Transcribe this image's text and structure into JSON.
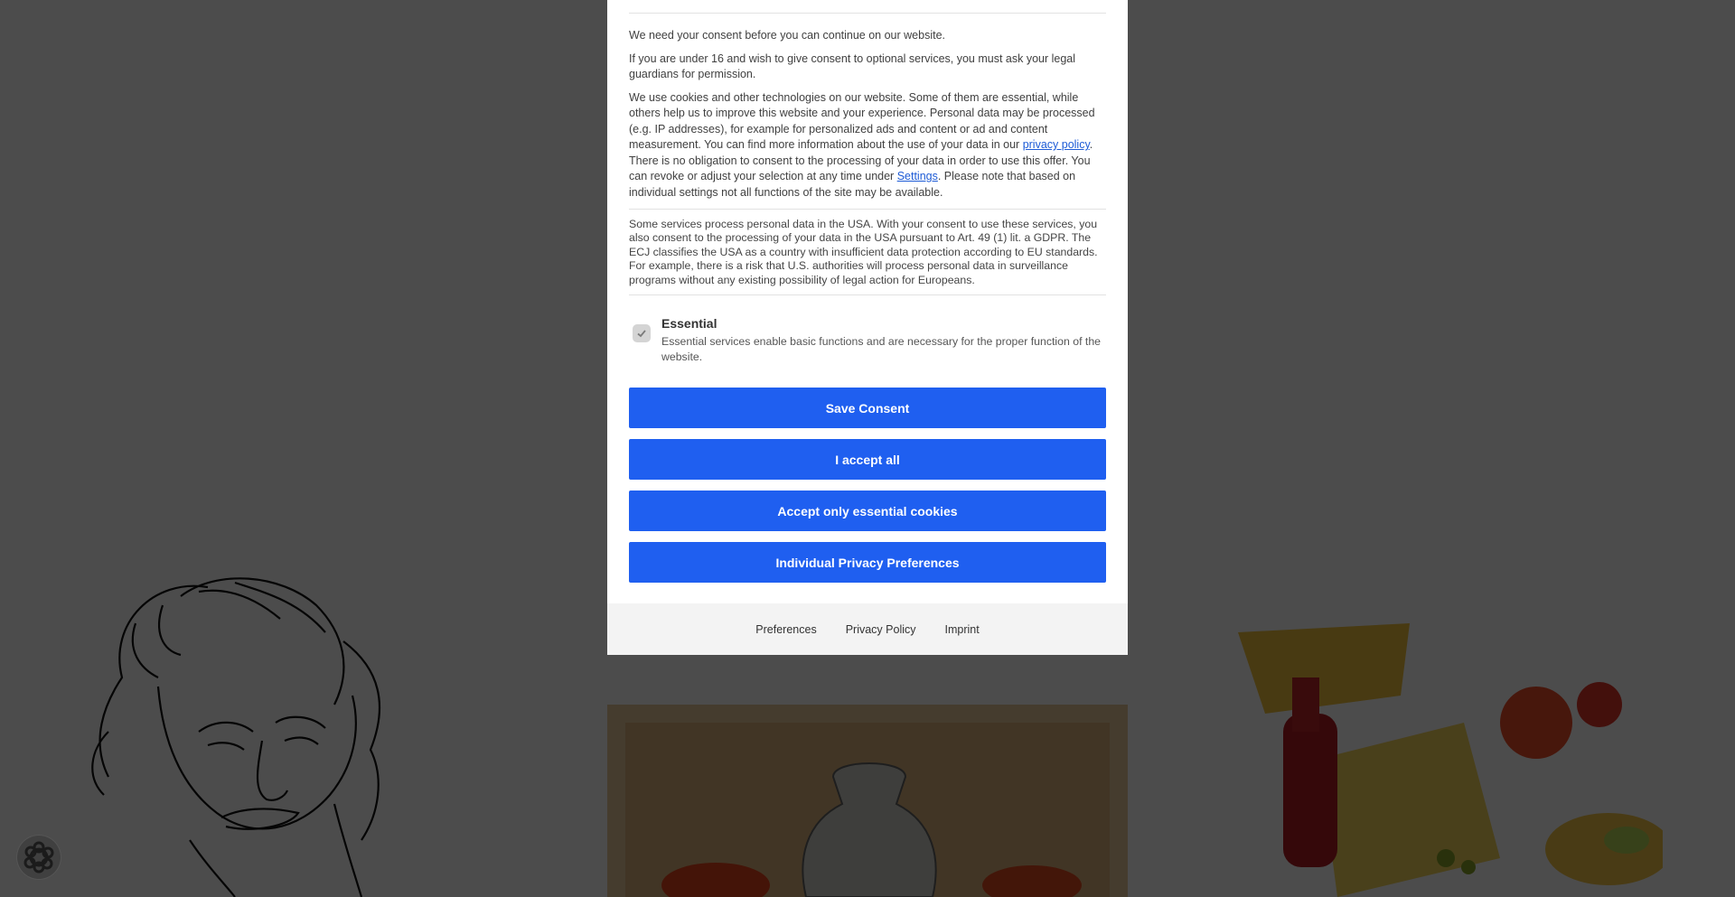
{
  "consent_dialog": {
    "intro": "We need your consent before you can continue on our website.",
    "under16": "If you are under 16 and wish to give consent to optional services, you must ask your legal guardians for permission.",
    "cookies_text_1": "We use cookies and other technologies on our website. Some of them are essential, while others help us to improve this website and your experience. Personal data may be processed (e.g. IP addresses), for example for personalized ads and content or ad and content measurement. You can find more information about the use of your data in our ",
    "privacy_policy_link": "privacy policy",
    "cookies_text_2": ". There is no obligation to consent to the processing of your data in order to use this offer. You can revoke or adjust your selection at any time under ",
    "settings_link": "Settings",
    "cookies_text_3": ". Please note that based on individual settings not all functions of the site may be available.",
    "usa_notice": "Some services process personal data in the USA. With your consent to use these services, you also consent to the processing of your data in the USA pursuant to Art. 49 (1) lit. a GDPR. The ECJ classifies the USA as a country with insufficient data protection according to EU standards. For example, there is a risk that U.S. authorities will process personal data in surveillance programs without any existing possibility of legal action for Europeans.",
    "essential": {
      "title": "Essential",
      "description": "Essential services enable basic functions and are necessary for the proper function of the website.",
      "checked": true
    },
    "buttons": {
      "save": "Save Consent",
      "accept_all": "I accept all",
      "essential_only": "Accept only essential cookies",
      "individual": "Individual Privacy Preferences"
    },
    "footer": {
      "preferences": "Preferences",
      "privacy_policy": "Privacy Policy",
      "imprint": "Imprint"
    }
  },
  "colors": {
    "button": "#1f5ff0",
    "link": "#1d5bd6",
    "overlay": "rgba(0,0,0,0.70)"
  },
  "icons": {
    "floating_button": "privacy-settings-icon",
    "checkbox": "checkmark-icon"
  }
}
